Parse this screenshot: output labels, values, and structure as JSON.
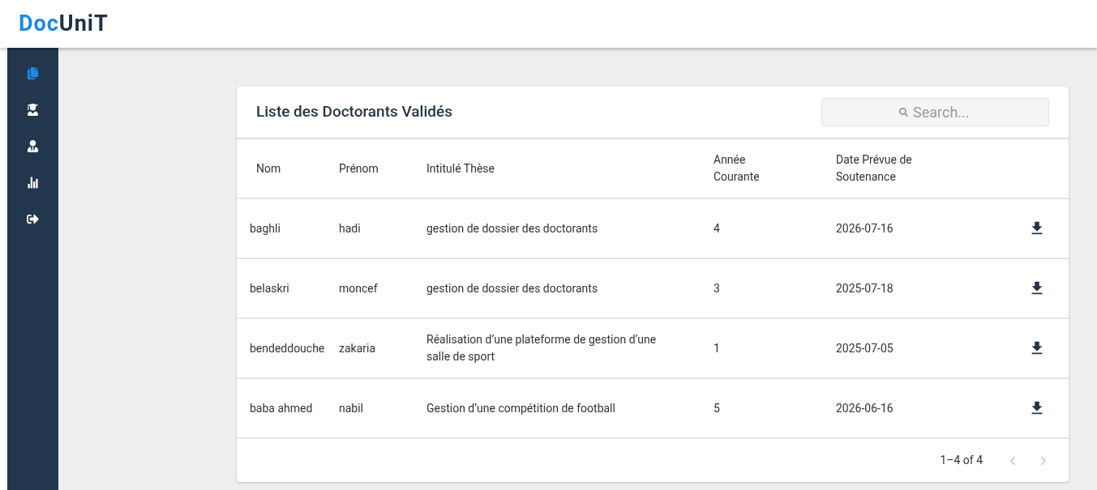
{
  "logo": [
    {
      "text": "Doc",
      "color": "#1e88e5"
    },
    {
      "text": "UniT",
      "color": "#1f3047"
    }
  ],
  "sidebar": {
    "items": [
      {
        "kind": "documents",
        "selected": true
      },
      {
        "kind": "graduate",
        "selected": false
      },
      {
        "kind": "person",
        "selected": false
      },
      {
        "kind": "chart",
        "selected": false
      },
      {
        "kind": "logout",
        "selected": false
      }
    ]
  },
  "card": {
    "title": "Liste des Doctorants Validés",
    "search": {
      "placeholder": "Search..."
    },
    "table": {
      "columns": [
        "Nom",
        "Prénom",
        "Intitulé Thèse",
        "Année Courante",
        "Date Prévue de Soutenance"
      ],
      "rows": [
        {
          "cells": [
            "baghli",
            "hadi",
            "gestion de dossier des doctorants",
            "4",
            "2026-07-16"
          ]
        },
        {
          "cells": [
            "belaskri",
            "moncef",
            "gestion de dossier des doctorants",
            "3",
            "2025-07-18"
          ]
        },
        {
          "cells": [
            "bendeddouche",
            "zakaria",
            "Réalisation d’une plateforme de gestion d’une salle de sport",
            "1",
            "2025-07-05"
          ]
        },
        {
          "cells": [
            "baba ahmed",
            "nabil",
            "Gestion d’une compétition de football",
            "5",
            "2026-06-16"
          ]
        }
      ]
    },
    "pagination": {
      "range": "1–4 of 4",
      "prev_disabled": true,
      "next_disabled": true
    }
  }
}
